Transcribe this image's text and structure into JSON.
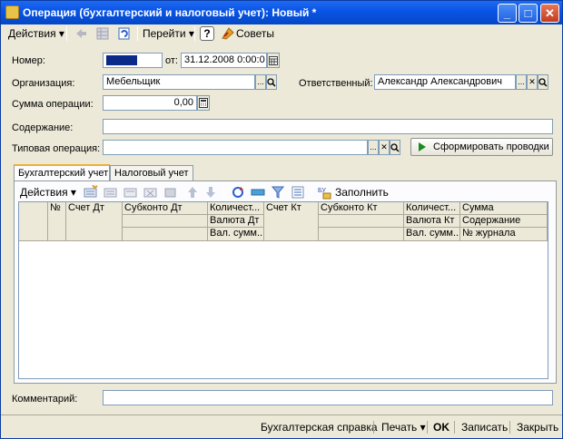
{
  "window": {
    "title": "Операция (бухгалтерский и налоговый учет): Новый *",
    "minimize": "_",
    "maximize": "□",
    "close": "✕"
  },
  "toolbar": {
    "actions": "Действия ▾",
    "goto": "Перейти ▾",
    "help": "?",
    "tips": "Советы"
  },
  "form": {
    "number_label": "Номер:",
    "number_value": "",
    "date_label": "от:",
    "date_value": "31.12.2008  0:00:0",
    "org_label": "Организация:",
    "org_value": "Мебельщик",
    "resp_label": "Ответственный:",
    "resp_value": "Александр Александрович",
    "sum_label": "Сумма операции:",
    "sum_value": "0,00",
    "content_label": "Содержание:",
    "content_value": "",
    "typical_label": "Типовая операция:",
    "typical_value": "",
    "generate_button": "Сформировать проводки"
  },
  "tabs": [
    "Бухгалтерский учет",
    "Налоговый учет"
  ],
  "table_toolbar": {
    "actions": "Действия ▾",
    "fill": "Заполнить"
  },
  "table": {
    "headers": {
      "num": "№",
      "acc_dt": "Счет Дт",
      "sub_dt": "Субконто Дт",
      "qty_dt": "Количест...",
      "cur_dt": "Валюта Дт",
      "val_dt": "Вал. сумм...",
      "acc_kt": "Счет Кт",
      "sub_kt": "Субконто Кт",
      "qty_kt": "Количест...",
      "cur_kt": "Валюта Кт",
      "val_kt": "Вал. сумм...",
      "sum": "Сумма",
      "content": "Содержание",
      "journal": "№ журнала"
    }
  },
  "comment": {
    "label": "Комментарий:",
    "value": ""
  },
  "footer": {
    "report": "Бухгалтерская справка",
    "print": "Печать ▾",
    "ok": "OK",
    "save": "Записать",
    "close": "Закрыть"
  },
  "colors": {
    "title_bar": "#0a55e8",
    "window_bg": "#ece9d8",
    "number_fill": "#0a2a8a",
    "generate_icon": "#1a8a1a"
  }
}
